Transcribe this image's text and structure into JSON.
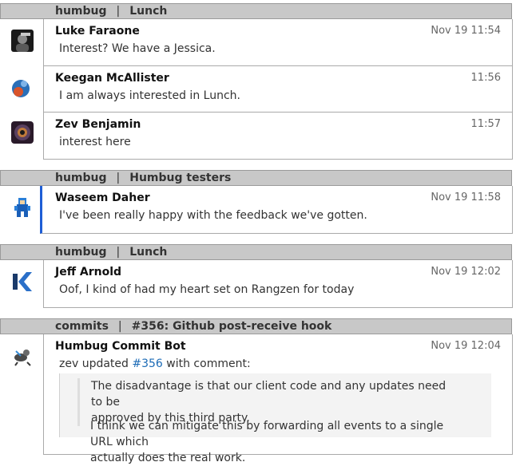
{
  "groups": [
    {
      "stream": "humbug",
      "topic": "Lunch",
      "messages": [
        {
          "sender": "Luke Faraone",
          "time": "Nov 19 11:54",
          "content": "Interest? We have a Jessica."
        },
        {
          "sender": "Keegan McAllister",
          "time": "11:56",
          "content": "I am always interested in Lunch."
        },
        {
          "sender": "Zev Benjamin",
          "time": "11:57",
          "content": "interest here"
        }
      ]
    },
    {
      "stream": "humbug",
      "topic": "Humbug testers",
      "messages": [
        {
          "sender": "Waseem Daher",
          "time": "Nov 19 11:58",
          "content": "I've been really happy with the feedback we've gotten."
        }
      ]
    },
    {
      "stream": "humbug",
      "topic": "Lunch",
      "messages": [
        {
          "sender": "Jeff Arnold",
          "time": "Nov 19 12:02",
          "content": "Oof, I kind of had my heart set on Rangzen for today"
        }
      ]
    },
    {
      "stream": "commits",
      "topic": "#356: Github post-receive hook",
      "messages": [
        {
          "sender": "Humbug Commit Bot",
          "time": "Nov 19 12:04",
          "prefix": "zev updated",
          "link": "#356",
          "suffix": "with comment:",
          "quote_line1": "The disadvantage is that our client code and any updates need to be",
          "quote_line2": "approved by this third party.",
          "reply_line1": "I think we can mitigate this by forwarding all events to a single URL which",
          "reply_line2": "actually does the real work."
        }
      ]
    }
  ],
  "separator": "|",
  "colors": {
    "selected_bar": "#1e5ed6",
    "header_bg": "#c8c8c8",
    "link": "#1c6bb6"
  }
}
